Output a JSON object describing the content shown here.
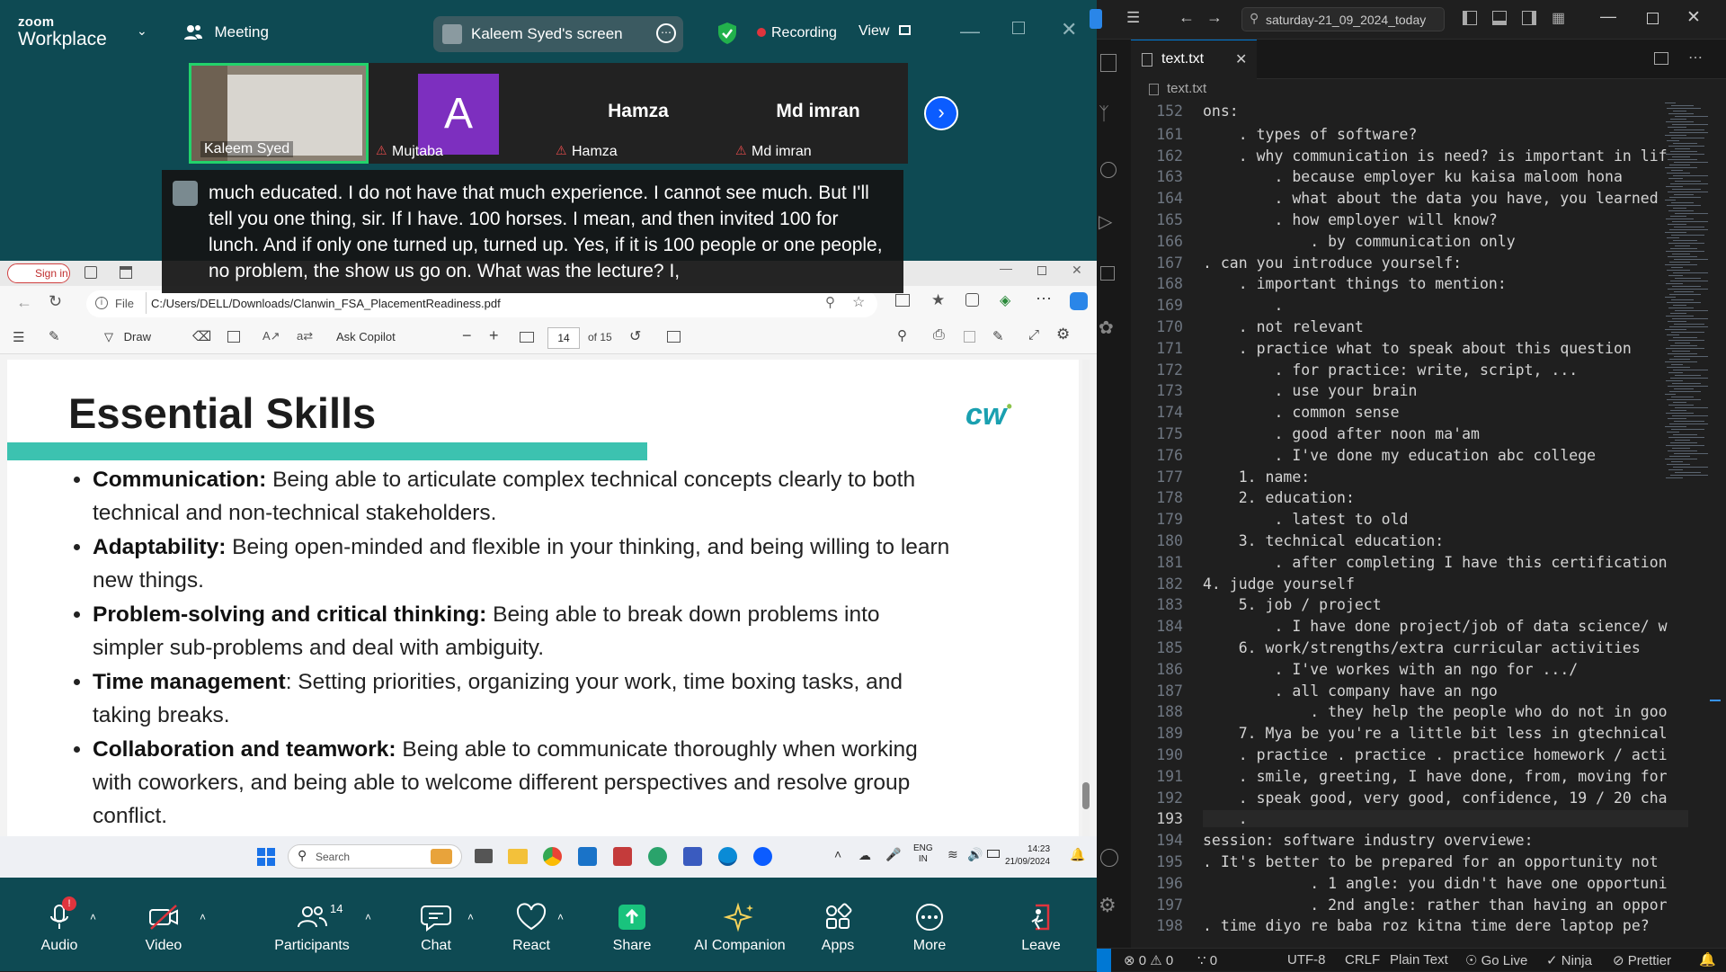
{
  "zoom": {
    "logo_small": "zoom",
    "logo_big": "Workplace",
    "meeting_label": "Meeting",
    "share_label": "Kaleem Syed's screen",
    "recording_label": "Recording",
    "view_label": "View",
    "participants": [
      {
        "name": "Kaleem Syed",
        "big": ""
      },
      {
        "name": "Mujtaba",
        "big": "A"
      },
      {
        "name": "Hamza",
        "big": "Hamza"
      },
      {
        "name": "Md imran",
        "big": "Md imran"
      }
    ],
    "caption": "much educated. I do not have that much experience. I cannot see much. But I'll tell you one thing, sir. If I have. 100 horses. I mean, and then invited 100 for lunch. And if only one turned up, turned up. Yes, if it is 100 people or one people, no problem, the show us go on. What was the lecture? I,",
    "controls": {
      "audio": "Audio",
      "audio_badge": "!",
      "video": "Video",
      "participants": "Participants",
      "participants_count": "14",
      "chat": "Chat",
      "react": "React",
      "share": "Share",
      "ai": "AI Companion",
      "apps": "Apps",
      "more": "More",
      "leave": "Leave"
    }
  },
  "edge": {
    "sign_in": "Sign in",
    "file_label": "File",
    "url": "C:/Users/DELL/Downloads/Clanwin_FSA_PlacementReadiness.pdf",
    "draw": "Draw",
    "ask_copilot": "Ask Copilot",
    "page_num": "14",
    "page_total": "of 15"
  },
  "pdf": {
    "title": "Essential Skills",
    "logo": "cw",
    "bullets": [
      {
        "bold": "Communication:",
        "text": " Being able to articulate complex technical concepts clearly to both technical and non-technical stakeholders."
      },
      {
        "bold": "Adaptability:",
        "text": " Being open-minded and flexible in your thinking, and being willing to learn new things."
      },
      {
        "bold": "Problem-solving and critical thinking:",
        "text": " Being able to break down problems into simpler sub-problems and deal with ambiguity."
      },
      {
        "bold": "Time management",
        "text": ": Setting priorities, organizing your work, time boxing tasks, and taking breaks."
      },
      {
        "bold": "Collaboration and teamwork:",
        "text": " Being able to communicate thoroughly when working with coworkers, and being able to welcome different perspectives and resolve group conflict."
      }
    ]
  },
  "taskbar": {
    "search": "Search",
    "lang1": "ENG",
    "lang2": "IN",
    "time": "14:23",
    "date": "21/09/2024"
  },
  "vscode": {
    "search": "saturday-21_09_2024_today",
    "tab": "text.txt",
    "breadcrumb": "text.txt",
    "sticky_num": "152",
    "sticky_text": "ons:",
    "lines": [
      {
        "n": "161",
        "t": "    . types of software?"
      },
      {
        "n": "162",
        "t": "    . why communication is need? is important in lif"
      },
      {
        "n": "163",
        "t": "        . because employer ku kaisa maloom hona"
      },
      {
        "n": "164",
        "t": "        . what about the data you have, you learned"
      },
      {
        "n": "165",
        "t": "        . how employer will know?"
      },
      {
        "n": "166",
        "t": "            . by communication only"
      },
      {
        "n": "167",
        "t": ". can you introduce yourself:"
      },
      {
        "n": "168",
        "t": "    . important things to mention:"
      },
      {
        "n": "169",
        "t": "        ."
      },
      {
        "n": "170",
        "t": "    . not relevant"
      },
      {
        "n": "171",
        "t": "    . practice what to speak about this question"
      },
      {
        "n": "172",
        "t": "        . for practice: write, script, ..."
      },
      {
        "n": "173",
        "t": "        . use your brain"
      },
      {
        "n": "174",
        "t": "        . common sense"
      },
      {
        "n": "175",
        "t": "        . good after noon ma'am"
      },
      {
        "n": "176",
        "t": "        . I've done my education abc college"
      },
      {
        "n": "177",
        "t": "    1. name:"
      },
      {
        "n": "178",
        "t": "    2. education:"
      },
      {
        "n": "179",
        "t": "        . latest to old"
      },
      {
        "n": "180",
        "t": "    3. technical education:"
      },
      {
        "n": "181",
        "t": "        . after completing I have this certification"
      },
      {
        "n": "182",
        "t": "4. judge yourself"
      },
      {
        "n": "183",
        "t": "    5. job / project"
      },
      {
        "n": "184",
        "t": "        . I have done project/job of data science/ w"
      },
      {
        "n": "185",
        "t": "    6. work/strengths/extra curricular activities"
      },
      {
        "n": "186",
        "t": "        . I've workes with an ngo for .../"
      },
      {
        "n": "187",
        "t": "        . all company have an ngo"
      },
      {
        "n": "188",
        "t": "            . they help the people who do not in goo"
      },
      {
        "n": "189",
        "t": "    7. Mya be you're a little bit less in gtechnical"
      },
      {
        "n": "190",
        "t": "    . practice . practice . practice homework / acti"
      },
      {
        "n": "191",
        "t": "    . smile, greeting, I have done, from, moving for"
      },
      {
        "n": "192",
        "t": "    . speak good, very good, confidence, 19 / 20 cha"
      },
      {
        "n": "193",
        "t": "    ."
      },
      {
        "n": "194",
        "t": "session: software industry overviewe:"
      },
      {
        "n": "195",
        "t": ". It's better to be prepared for an opportunity not"
      },
      {
        "n": "196",
        "t": "            . 1 angle: you didn't have one opportuni"
      },
      {
        "n": "197",
        "t": "            . 2nd angle: rather than having an oppor"
      },
      {
        "n": "198",
        "t": ". time diyo re baba roz kitna time dere laptop pe?"
      }
    ],
    "status": {
      "errors": "0",
      "warnings": "0",
      "ports": "0",
      "encoding": "UTF-8",
      "eol": "CRLF",
      "lang": "Plain Text",
      "golive": "Go Live",
      "ninja": "Ninja",
      "prettier": "Prettier"
    }
  },
  "colors": {
    "zoom_bg": "#0e4a53",
    "pdf_accent": "#3cc2b0",
    "vscode_bg": "#1f1f1f",
    "recording": "#e0343d",
    "share_green": "#19c37d"
  }
}
